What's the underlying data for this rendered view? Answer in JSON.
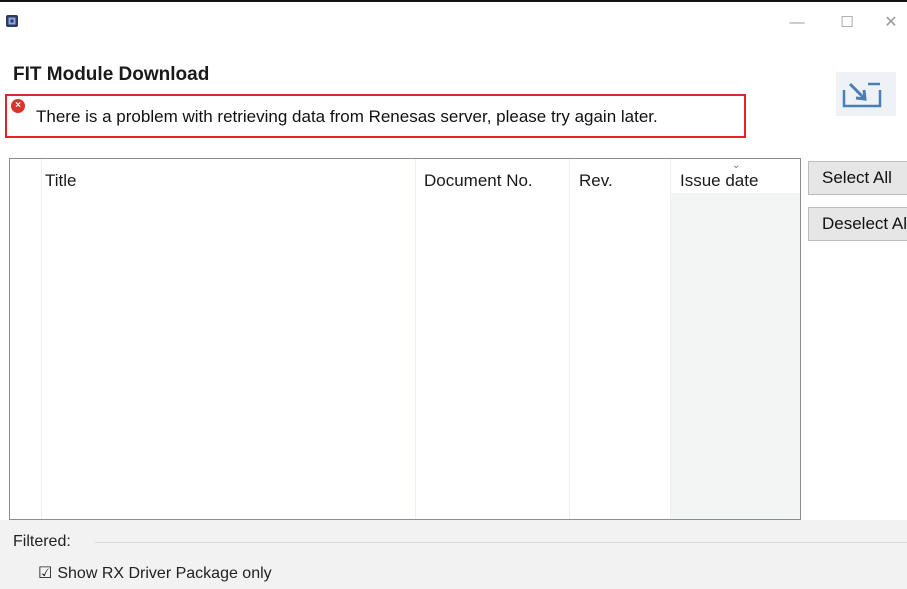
{
  "window": {
    "minimize_glyph": "—",
    "maximize_glyph": "☐",
    "close_glyph": "✕"
  },
  "header": {
    "title": "FIT Module Download"
  },
  "error": {
    "icon_glyph": "×",
    "message": "There is a problem with retrieving data from Renesas server, please try again later."
  },
  "table": {
    "columns": [
      "Title",
      "Document No.",
      "Rev.",
      "Issue date"
    ],
    "sort_indicator": "⌄",
    "rows": []
  },
  "buttons": {
    "select_all": "Select All",
    "deselect_all": "Deselect All"
  },
  "filter": {
    "label": "Filtered:",
    "checkbox_glyph": "☑",
    "checkbox_label": "Show RX Driver Package only",
    "checked": true
  },
  "colors": {
    "error_border": "#e0242a",
    "error_icon": "#d8362b",
    "button_bg": "#e6e6e6",
    "column_shade": "#f3f4f4"
  },
  "icons": [
    "app-icon",
    "download-banner-icon",
    "error-icon"
  ]
}
